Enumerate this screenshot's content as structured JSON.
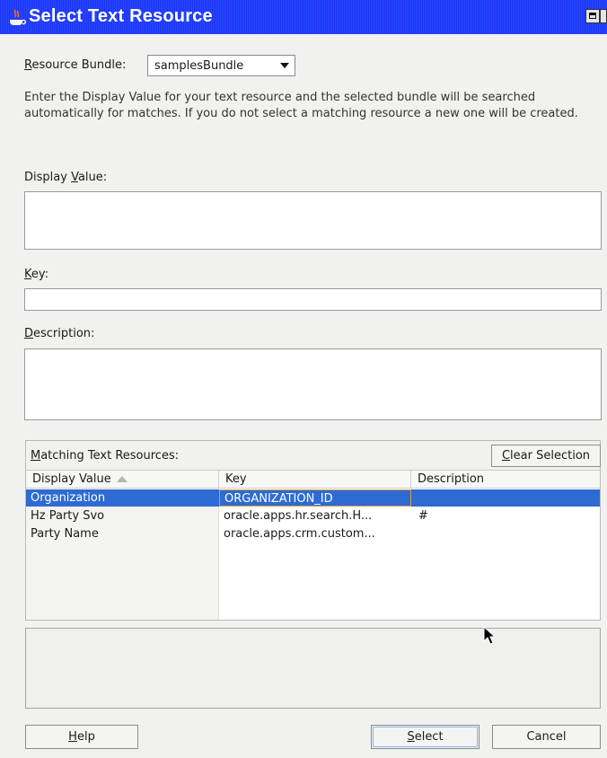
{
  "window": {
    "title": "Select Text Resource"
  },
  "resource_bundle": {
    "label": "Resource Bundle:",
    "label_mnemonic": "R",
    "label_rest": "esource Bundle:",
    "selected": "samplesBundle"
  },
  "instructions": "Enter the Display Value for your text resource and the selected bundle will be searched automatically for matches.  If you do not select a matching resource a new one will be created.",
  "display_value": {
    "label_pre": "Display ",
    "label_mnemonic": "V",
    "label_post": "alue:",
    "value": ""
  },
  "key": {
    "label_mnemonic": "K",
    "label_post": "ey:",
    "value": ""
  },
  "description": {
    "label_mnemonic": "D",
    "label_post": "escription:",
    "value": ""
  },
  "matching": {
    "label_pre": "",
    "label_mnemonic": "M",
    "label_post": "atching Text Resources:",
    "clear_mnemonic": "C",
    "clear_post": "lear Selection",
    "columns": [
      "Display Value",
      "Key",
      "Description"
    ],
    "rows": [
      {
        "display": "Organization",
        "key": "ORGANIZATION_ID",
        "description": "",
        "selected": true
      },
      {
        "display": "Hz Party Svo",
        "key": "oracle.apps.hr.search.H...",
        "description": "#",
        "selected": false
      },
      {
        "display": "Party Name",
        "key": "oracle.apps.crm.custom...",
        "description": "",
        "selected": false
      }
    ]
  },
  "buttons": {
    "help_mnemonic": "H",
    "help_post": "elp",
    "select_mnemonic": "S",
    "select_post": "elect",
    "cancel": "Cancel"
  },
  "colors": {
    "titlebar": "#2746ff",
    "selection": "#2d6bd2",
    "focus_border": "#e09c3b"
  },
  "icons": [
    "java-cup-icon",
    "maximize-icon",
    "close-icon",
    "pencil-icon",
    "sort-ascending-icon",
    "mouse-cursor-icon"
  ]
}
